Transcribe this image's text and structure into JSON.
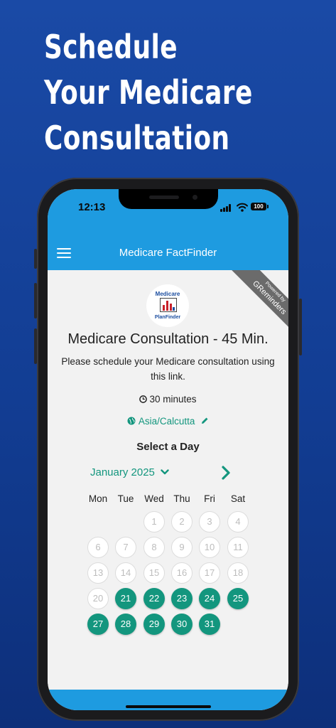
{
  "headline": [
    "Schedule",
    "Your Medicare",
    "Consultation"
  ],
  "status": {
    "time": "12:13",
    "battery": "100"
  },
  "appbar": {
    "title": "Medicare FactFinder"
  },
  "ribbon": {
    "line1": "Powered by",
    "line2": "GReminders"
  },
  "logo": {
    "top_text": "Medicare",
    "bottom_text": "PlanFinder"
  },
  "event": {
    "title": "Medicare Consultation - 45 Min.",
    "description": "Please schedule your Medicare consultation using this link.",
    "duration": "30 minutes",
    "timezone": "Asia/Calcutta"
  },
  "calendar": {
    "heading": "Select a Day",
    "month_label": "January 2025",
    "weekdays": [
      "Mon",
      "Tue",
      "Wed",
      "Thu",
      "Fri",
      "Sat"
    ],
    "days_off": [
      "1",
      "2",
      "3",
      "4",
      "6",
      "7",
      "8",
      "9",
      "10",
      "11",
      "13",
      "14",
      "15",
      "16",
      "17",
      "18",
      "20"
    ],
    "days_available": [
      "21",
      "22",
      "23",
      "24",
      "25",
      "27",
      "28",
      "29",
      "30",
      "31"
    ]
  },
  "colors": {
    "accent": "#13967e",
    "appbar": "#1e9be0",
    "background": "#1a4aa6"
  }
}
